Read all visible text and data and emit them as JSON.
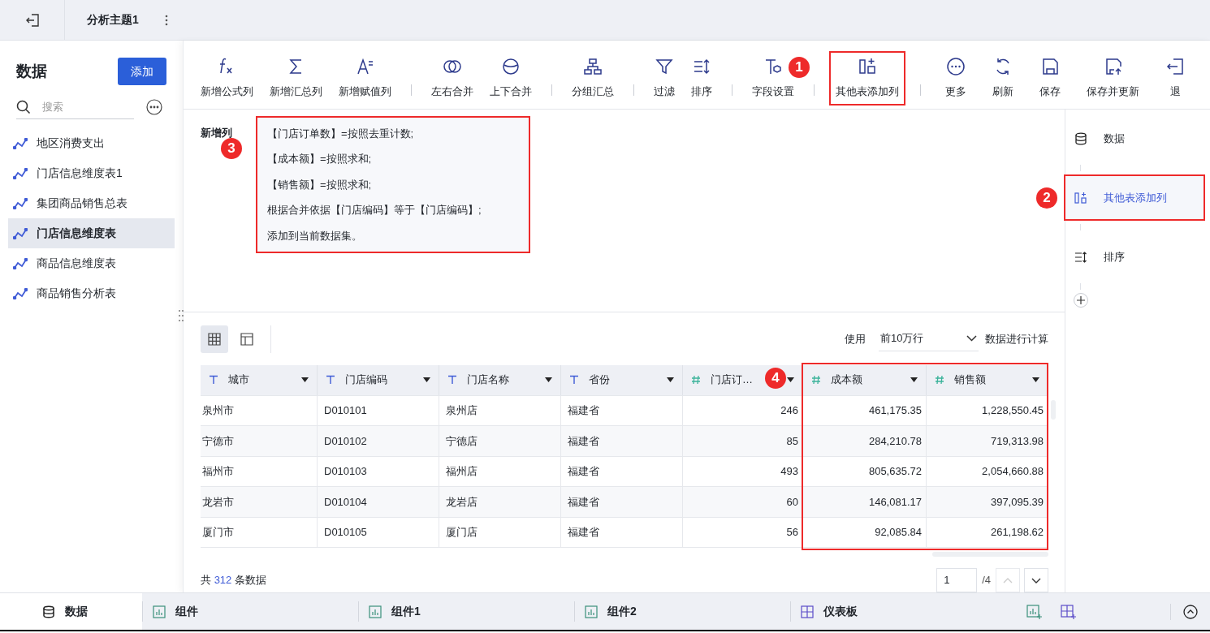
{
  "top_bar": {
    "title": "分析主题1"
  },
  "sidebar": {
    "title": "数据",
    "add_button": "添加",
    "search": {
      "placeholder": "搜索"
    },
    "items": [
      {
        "label": "地区消费支出",
        "selected": false
      },
      {
        "label": "门店信息维度表1",
        "selected": false
      },
      {
        "label": "集团商品销售总表",
        "selected": false
      },
      {
        "label": "门店信息维度表",
        "selected": true
      },
      {
        "label": "商品信息维度表",
        "selected": false
      },
      {
        "label": "商品销售分析表",
        "selected": false
      }
    ]
  },
  "toolbar": {
    "groups": [
      [
        {
          "label": "新增公式列"
        },
        {
          "label": "新增汇总列"
        },
        {
          "label": "新增赋值列"
        }
      ],
      [
        {
          "label": "左右合并"
        },
        {
          "label": "上下合并"
        }
      ],
      [
        {
          "label": "分组汇总"
        }
      ],
      [
        {
          "label": "过滤"
        },
        {
          "label": "排序"
        }
      ],
      [
        {
          "label": "字段设置"
        }
      ],
      [
        {
          "label": "其他表添加列",
          "annotation": "1"
        }
      ],
      [
        {
          "label": "更多"
        },
        {
          "label": "刷新"
        },
        {
          "label": "保存"
        },
        {
          "label": "保存并更新"
        },
        {
          "label": "退"
        }
      ]
    ]
  },
  "formula": {
    "label": "新增列",
    "annotation": "3",
    "lines": [
      "【门店订单数】=按照去重计数;",
      "【成本额】=按照求和;",
      "【销售额】=按照求和;",
      "根据合并依据【门店编码】等于【门店编码】;",
      "添加到当前数据集。"
    ]
  },
  "table": {
    "view_toggle": [
      {
        "selected": true
      },
      {
        "selected": false
      }
    ],
    "row_limit": {
      "prefix": "使用",
      "value": "前10万行",
      "suffix": "数据进行计算"
    },
    "annotation": "4",
    "columns": [
      {
        "name": "城市",
        "kind": "text",
        "highlighted": false
      },
      {
        "name": "门店编码",
        "kind": "text",
        "highlighted": false
      },
      {
        "name": "门店名称",
        "kind": "text",
        "highlighted": false
      },
      {
        "name": "省份",
        "kind": "text",
        "highlighted": false
      },
      {
        "name": "门店订…",
        "kind": "number",
        "highlighted": false
      },
      {
        "name": "成本额",
        "kind": "number",
        "highlighted": true
      },
      {
        "name": "销售额",
        "kind": "number",
        "highlighted": true
      }
    ],
    "rows": [
      [
        "泉州市",
        "D010101",
        "泉州店",
        "福建省",
        "246",
        "461,175.35",
        "1,228,550.45"
      ],
      [
        "宁德市",
        "D010102",
        "宁德店",
        "福建省",
        "85",
        "284,210.78",
        "719,313.98"
      ],
      [
        "福州市",
        "D010103",
        "福州店",
        "福建省",
        "493",
        "805,635.72",
        "2,054,660.88"
      ],
      [
        "龙岩市",
        "D010104",
        "龙岩店",
        "福建省",
        "60",
        "146,081.17",
        "397,095.39"
      ],
      [
        "厦门市",
        "D010105",
        "厦门店",
        "福建省",
        "56",
        "92,085.84",
        "261,198.62"
      ]
    ],
    "footer": {
      "prefix": "共",
      "count": "312",
      "suffix": "条数据"
    },
    "pagination": {
      "page": "1",
      "total": "/4"
    }
  },
  "steps": [
    {
      "label": "数据",
      "selected": false
    },
    {
      "label": "其他表添加列",
      "selected": true,
      "annotation": "2"
    },
    {
      "label": "排序",
      "selected": false
    }
  ],
  "bottom_tabs": [
    {
      "label": "数据",
      "selected": true
    },
    {
      "label": "组件",
      "selected": false
    },
    {
      "label": "组件1",
      "selected": false
    },
    {
      "label": "组件2",
      "selected": false
    },
    {
      "label": "仪表板",
      "selected": false
    }
  ]
}
